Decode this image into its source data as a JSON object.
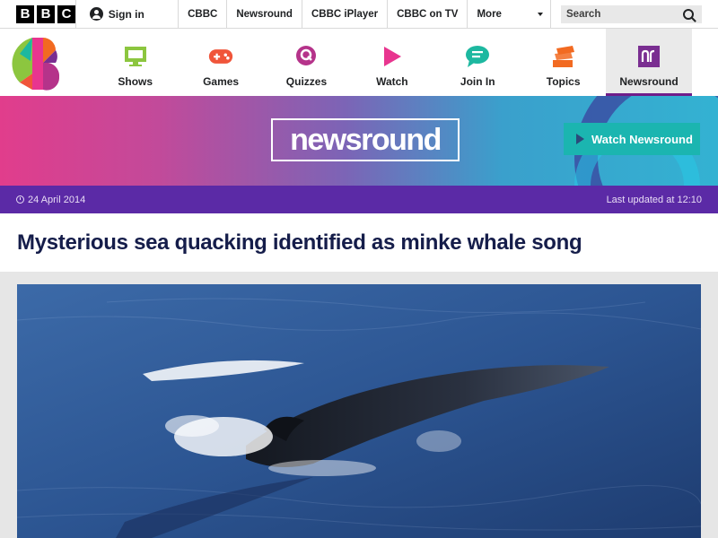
{
  "bbc_bar": {
    "logo_letters": [
      "B",
      "B",
      "C"
    ],
    "sign_in": "Sign in",
    "links": [
      "CBBC",
      "Newsround",
      "CBBC iPlayer",
      "CBBC on TV"
    ],
    "more": "More",
    "search_placeholder": "Search"
  },
  "cbbc_nav": {
    "items": [
      {
        "label": "Shows",
        "icon": "tv-icon",
        "color": "#8cc63f"
      },
      {
        "label": "Games",
        "icon": "gamepad-icon",
        "color": "#f0553a"
      },
      {
        "label": "Quizzes",
        "icon": "quiz-icon",
        "color": "#b5338a"
      },
      {
        "label": "Watch",
        "icon": "play-icon",
        "color": "#e8358f"
      },
      {
        "label": "Join In",
        "icon": "chat-icon",
        "color": "#1db8a0"
      },
      {
        "label": "Topics",
        "icon": "topics-icon",
        "color": "#f26a21"
      },
      {
        "label": "Newsround",
        "icon": "newsround-icon",
        "color": "#7a2e91"
      }
    ],
    "active": "Newsround"
  },
  "banner": {
    "logo_text": "newsround",
    "watch_button": "Watch Newsround"
  },
  "article": {
    "date": "24 April 2014",
    "updated": "Last updated at 12:10",
    "headline": "Mysterious sea quacking identified as minke whale song",
    "hero_alt": "minke whale surfacing"
  },
  "colors": {
    "purple_strip": "#5b2aa6",
    "headline": "#151d4a",
    "watch_button": "#1bb5b0"
  }
}
